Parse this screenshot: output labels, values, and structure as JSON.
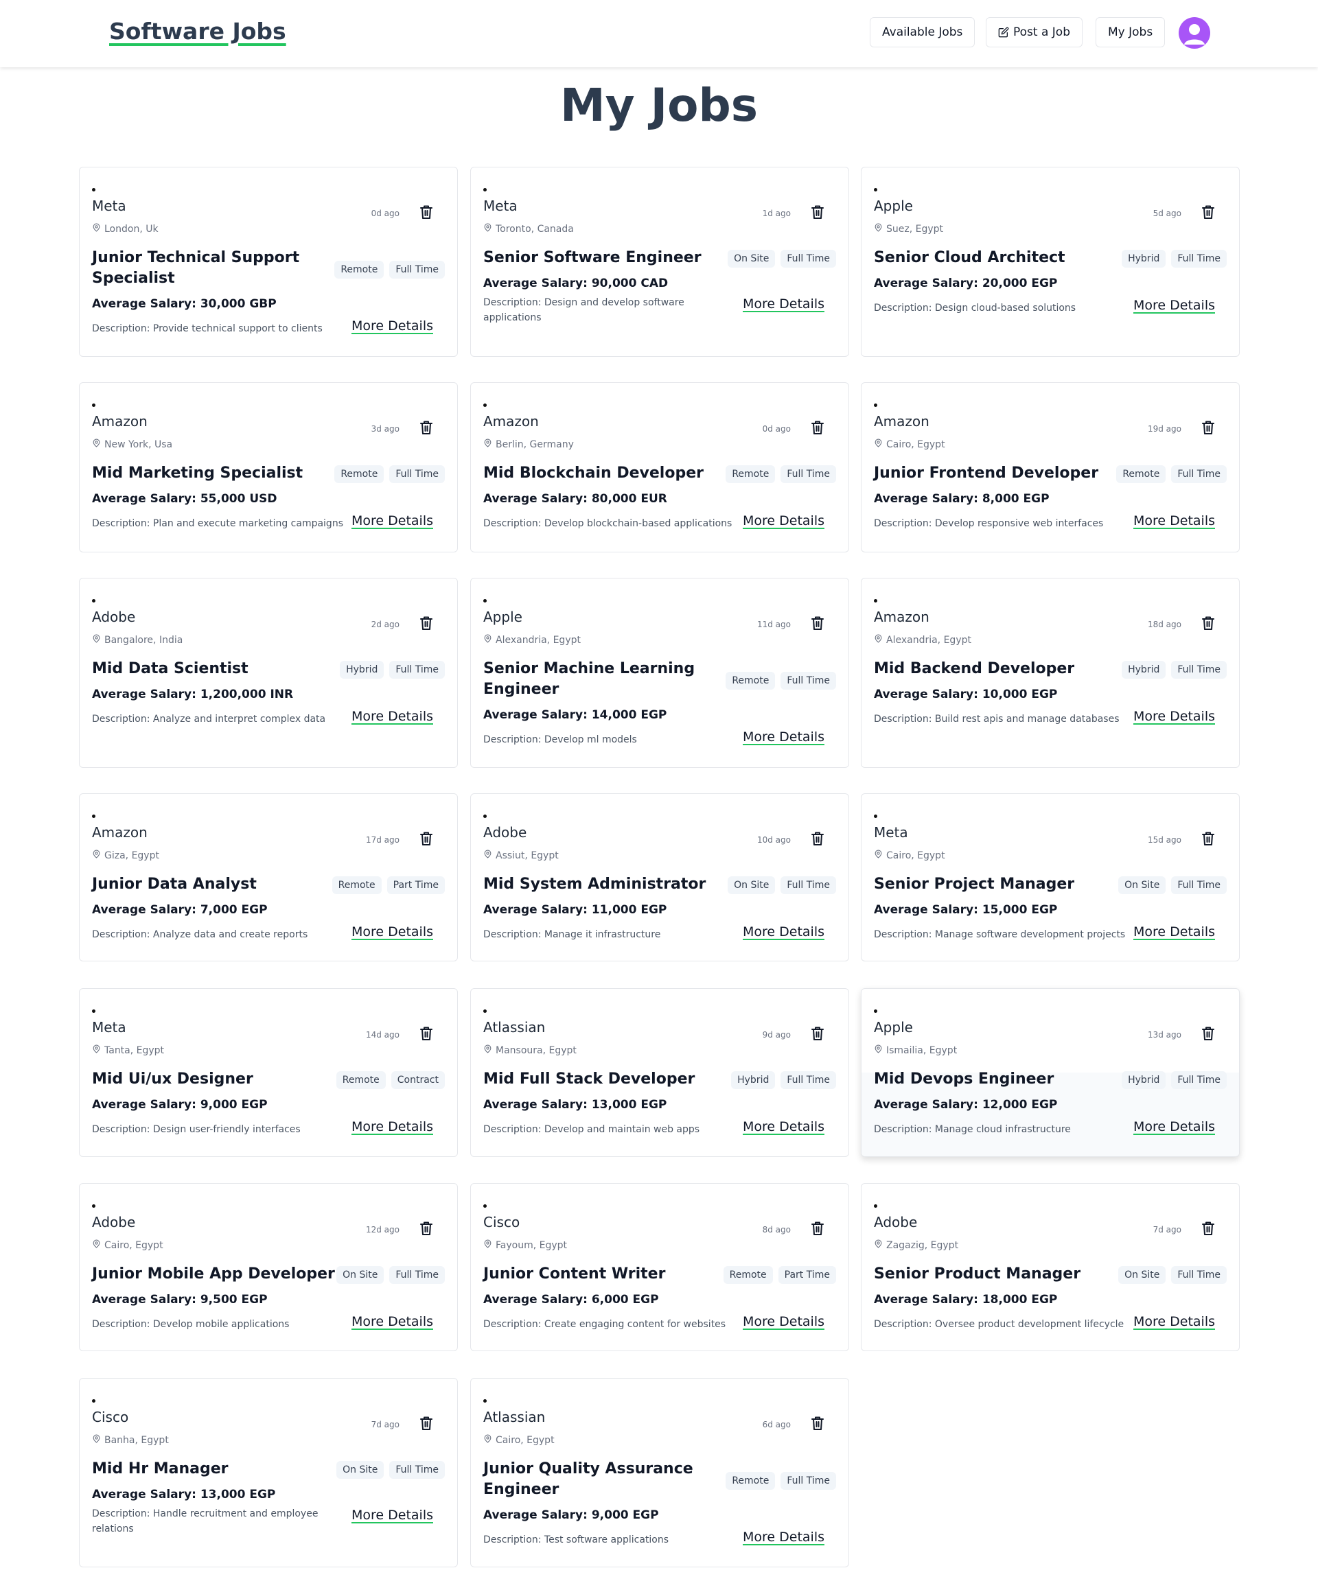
{
  "nav": {
    "brand": "Software Jobs",
    "available_jobs": "Available Jobs",
    "post_job": "Post a Job",
    "my_jobs": "My Jobs"
  },
  "page": {
    "title": "My Jobs"
  },
  "jobs": [
    {
      "company": "Meta",
      "location": "London, Uk",
      "ago": "0d ago",
      "title": "Junior Technical Support Specialist",
      "tags": [
        "Remote",
        "Full Time"
      ],
      "salary": "Average Salary: 30,000 GBP",
      "description": "Description: Provide technical support to clients",
      "more": "More Details"
    },
    {
      "company": "Meta",
      "location": "Toronto, Canada",
      "ago": "1d ago",
      "title": "Senior Software Engineer",
      "tags": [
        "On Site",
        "Full Time"
      ],
      "salary": "Average Salary: 90,000 CAD",
      "description": "Description: Design and develop software applications",
      "more": "More Details"
    },
    {
      "company": "Apple",
      "location": "Suez, Egypt",
      "ago": "5d ago",
      "title": "Senior Cloud Architect",
      "tags": [
        "Hybrid",
        "Full Time"
      ],
      "salary": "Average Salary: 20,000 EGP",
      "description": "Description: Design cloud-based solutions",
      "more": "More Details"
    },
    {
      "company": "Amazon",
      "location": "New York, Usa",
      "ago": "3d ago",
      "title": "Mid Marketing Specialist",
      "tags": [
        "Remote",
        "Full Time"
      ],
      "salary": "Average Salary: 55,000 USD",
      "description": "Description: Plan and execute marketing campaigns",
      "more": "More Details"
    },
    {
      "company": "Amazon",
      "location": "Berlin, Germany",
      "ago": "0d ago",
      "title": "Mid Blockchain Developer",
      "tags": [
        "Remote",
        "Full Time"
      ],
      "salary": "Average Salary: 80,000 EUR",
      "description": "Description: Develop blockchain-based applications",
      "more": "More Details"
    },
    {
      "company": "Amazon",
      "location": "Cairo, Egypt",
      "ago": "19d ago",
      "title": "Junior Frontend Developer",
      "tags": [
        "Remote",
        "Full Time"
      ],
      "salary": "Average Salary: 8,000 EGP",
      "description": "Description: Develop responsive web interfaces",
      "more": "More Details"
    },
    {
      "company": "Adobe",
      "location": "Bangalore, India",
      "ago": "2d ago",
      "title": "Mid Data Scientist",
      "tags": [
        "Hybrid",
        "Full Time"
      ],
      "salary": "Average Salary: 1,200,000 INR",
      "description": "Description: Analyze and interpret complex data",
      "more": "More Details"
    },
    {
      "company": "Apple",
      "location": "Alexandria, Egypt",
      "ago": "11d ago",
      "title": "Senior Machine Learning Engineer",
      "tags": [
        "Remote",
        "Full Time"
      ],
      "salary": "Average Salary: 14,000 EGP",
      "description": "Description: Develop ml models",
      "more": "More Details"
    },
    {
      "company": "Amazon",
      "location": "Alexandria, Egypt",
      "ago": "18d ago",
      "title": "Mid Backend Developer",
      "tags": [
        "Hybrid",
        "Full Time"
      ],
      "salary": "Average Salary: 10,000 EGP",
      "description": "Description: Build rest apis and manage databases",
      "more": "More Details"
    },
    {
      "company": "Amazon",
      "location": "Giza, Egypt",
      "ago": "17d ago",
      "title": "Junior Data Analyst",
      "tags": [
        "Remote",
        "Part Time"
      ],
      "salary": "Average Salary: 7,000 EGP",
      "description": "Description: Analyze data and create reports",
      "more": "More Details"
    },
    {
      "company": "Adobe",
      "location": "Assiut, Egypt",
      "ago": "10d ago",
      "title": "Mid System Administrator",
      "tags": [
        "On Site",
        "Full Time"
      ],
      "salary": "Average Salary: 11,000 EGP",
      "description": "Description: Manage it infrastructure",
      "more": "More Details"
    },
    {
      "company": "Meta",
      "location": "Cairo, Egypt",
      "ago": "15d ago",
      "title": "Senior Project Manager",
      "tags": [
        "On Site",
        "Full Time"
      ],
      "salary": "Average Salary: 15,000 EGP",
      "description": "Description: Manage software development projects",
      "more": "More Details"
    },
    {
      "company": "Meta",
      "location": "Tanta, Egypt",
      "ago": "14d ago",
      "title": "Mid Ui/ux Designer",
      "tags": [
        "Remote",
        "Contract"
      ],
      "salary": "Average Salary: 9,000 EGP",
      "description": "Description: Design user-friendly interfaces",
      "more": "More Details"
    },
    {
      "company": "Atlassian",
      "location": "Mansoura, Egypt",
      "ago": "9d ago",
      "title": "Mid Full Stack Developer",
      "tags": [
        "Hybrid",
        "Full Time"
      ],
      "salary": "Average Salary: 13,000 EGP",
      "description": "Description: Develop and maintain web apps",
      "more": "More Details"
    },
    {
      "company": "Apple",
      "location": "Ismailia, Egypt",
      "ago": "13d ago",
      "title": "Mid Devops Engineer",
      "tags": [
        "Hybrid",
        "Full Time"
      ],
      "salary": "Average Salary: 12,000 EGP",
      "description": "Description: Manage cloud infrastructure",
      "more": "More Details"
    },
    {
      "company": "Adobe",
      "location": "Cairo, Egypt",
      "ago": "12d ago",
      "title": "Junior Mobile App Developer",
      "tags": [
        "On Site",
        "Full Time"
      ],
      "salary": "Average Salary: 9,500 EGP",
      "description": "Description: Develop mobile applications",
      "more": "More Details"
    },
    {
      "company": "Cisco",
      "location": "Fayoum, Egypt",
      "ago": "8d ago",
      "title": "Junior Content Writer",
      "tags": [
        "Remote",
        "Part Time"
      ],
      "salary": "Average Salary: 6,000 EGP",
      "description": "Description: Create engaging content for websites",
      "more": "More Details"
    },
    {
      "company": "Adobe",
      "location": "Zagazig, Egypt",
      "ago": "7d ago",
      "title": "Senior Product Manager",
      "tags": [
        "On Site",
        "Full Time"
      ],
      "salary": "Average Salary: 18,000 EGP",
      "description": "Description: Oversee product development lifecycle",
      "more": "More Details"
    },
    {
      "company": "Cisco",
      "location": "Banha, Egypt",
      "ago": "7d ago",
      "title": "Mid Hr Manager",
      "tags": [
        "On Site",
        "Full Time"
      ],
      "salary": "Average Salary: 13,000 EGP",
      "description": "Description: Handle recruitment and employee relations",
      "more": "More Details"
    },
    {
      "company": "Atlassian",
      "location": "Cairo, Egypt",
      "ago": "6d ago",
      "title": "Junior Quality Assurance Engineer",
      "tags": [
        "Remote",
        "Full Time"
      ],
      "salary": "Average Salary: 9,000 EGP",
      "description": "Description: Test software applications",
      "more": "More Details"
    }
  ]
}
